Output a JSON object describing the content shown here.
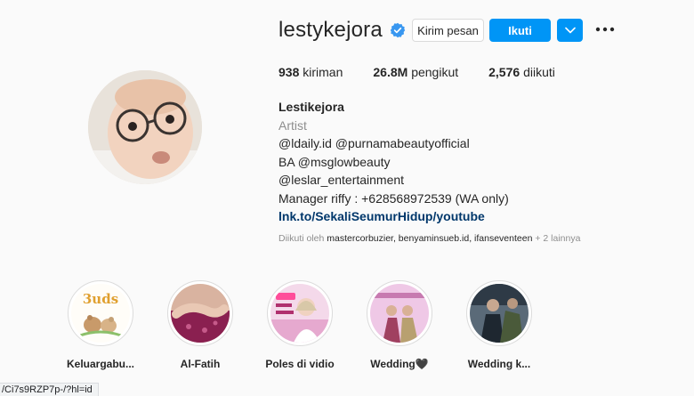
{
  "profile": {
    "username": "lestykejora",
    "message_label": "Kirim pesan",
    "follow_label": "Ikuti",
    "stats": [
      {
        "count": "938",
        "label": "kiriman"
      },
      {
        "count": "26.8M",
        "label": "pengikut"
      },
      {
        "count": "2,576",
        "label": "diikuti"
      }
    ],
    "bio": {
      "name": "Lestikejora",
      "category": "Artist",
      "lines": [
        "@ldaily.id @purnamabeautyofficial",
        "BA @msglowbeauty",
        "@leslar_entertainment",
        "Manager riffy : +628568972539 (WA only)"
      ],
      "link": "lnk.to/SekaliSeumurHidup/youtube"
    },
    "followed_by": {
      "prefix": "Diikuti oleh",
      "names": "mastercorbuzier, benyaminsueb.id, ifanseventeen",
      "suffix": "+ 2 lainnya"
    }
  },
  "highlights": [
    {
      "label": "Keluargabu..."
    },
    {
      "label": "Al-Fatih"
    },
    {
      "label": "Poles di vidio"
    },
    {
      "label": "Wedding🖤"
    },
    {
      "label": "Wedding k..."
    }
  ],
  "status_bar": {
    "url": "/Ci7s9RZP7p-/?hl=id"
  },
  "colors": {
    "accent": "#0095f6",
    "verified": "#3897f0",
    "link": "#00376b",
    "muted": "#8e8e8e"
  }
}
